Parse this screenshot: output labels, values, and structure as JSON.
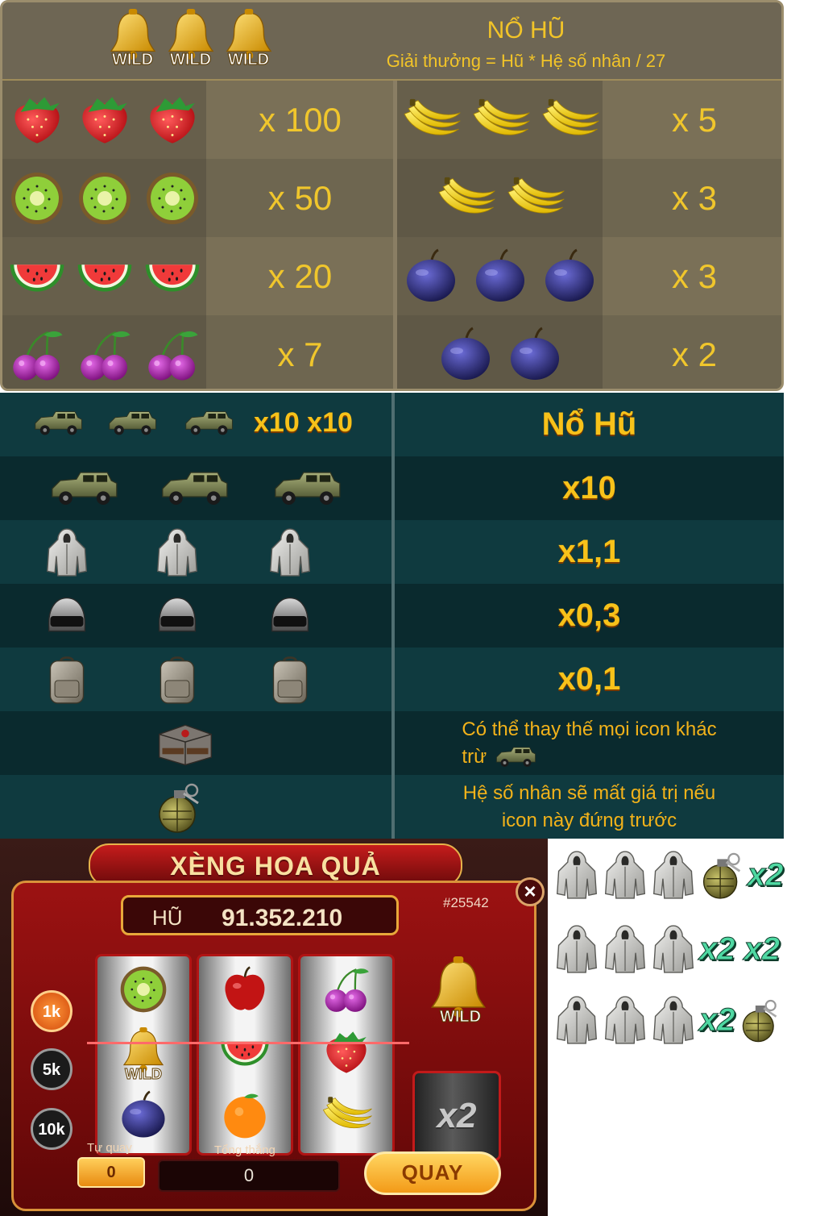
{
  "fruit_table": {
    "wild_label": "WILD",
    "title": "NỔ HŨ",
    "subtitle": "Giải thưởng = Hũ * Hệ số nhân / 27",
    "rows": [
      {
        "left_icon": "strawberry-icon",
        "left_count": 3,
        "left_mult": "x 100",
        "right_icon": "banana-icon",
        "right_count": 3,
        "right_mult": "x 5"
      },
      {
        "left_icon": "kiwi-icon",
        "left_count": 3,
        "left_mult": "x 50",
        "right_icon": "banana-icon",
        "right_count": 2,
        "right_mult": "x 3"
      },
      {
        "left_icon": "watermelon-icon",
        "left_count": 3,
        "left_mult": "x 20",
        "right_icon": "plum-icon",
        "right_count": 3,
        "right_mult": "x 3"
      },
      {
        "left_icon": "cherry-icon",
        "left_count": 3,
        "left_mult": "x 7",
        "right_icon": "plum-icon",
        "right_count": 2,
        "right_mult": "x 2"
      }
    ]
  },
  "pubg_table": {
    "rows": [
      {
        "icon": "jeep-icon",
        "count": 3,
        "left_text": "x10 x10",
        "right_text": "Nổ Hũ"
      },
      {
        "icon": "jeep-icon",
        "count": 3,
        "right_text": "x10"
      },
      {
        "icon": "jacket-icon",
        "count": 3,
        "right_text": "x1,1"
      },
      {
        "icon": "helmet-icon",
        "count": 3,
        "right_text": "x0,3"
      },
      {
        "icon": "backpack-icon",
        "count": 3,
        "right_text": "x0,1"
      },
      {
        "icon": "crate-icon",
        "count": 1,
        "right_text": "Có thể thay thế mọi icon khác",
        "right_text2": "trừ"
      },
      {
        "icon": "grenade-icon",
        "count": 1,
        "right_text": "Hệ số nhân sẽ mất giá trị nếu",
        "right_text2": "icon này đứng trước"
      }
    ]
  },
  "game": {
    "title": "XÈNG HOA QUẢ",
    "jackpot_label": "HŨ",
    "jackpot_value": "91.352.210",
    "session_id": "#25542",
    "close_icon": "close-icon",
    "bets": [
      "1k",
      "5k",
      "10k"
    ],
    "active_bet": "1k",
    "reels": [
      [
        "kiwi-icon",
        "bell-wild-icon",
        "plum-icon"
      ],
      [
        "apple-icon",
        "watermelon-icon",
        "orange-icon"
      ],
      [
        "cherry-icon",
        "strawberry-icon",
        "banana-icon"
      ]
    ],
    "wild_label": "WILD",
    "bonus_multiplier": "x2",
    "auto_spin_label": "Tự quay",
    "auto_spin_value": "0",
    "total_win_label": "Tổng thắng",
    "total_win_value": "0",
    "spin_label": "QUAY"
  },
  "combos": {
    "rows": [
      {
        "icons": [
          "jacket-icon",
          "jacket-icon",
          "jacket-icon",
          "grenade-icon"
        ],
        "mult": "x2"
      },
      {
        "icons": [
          "jacket-icon",
          "jacket-icon",
          "jacket-icon"
        ],
        "mult": "x2 x2"
      },
      {
        "icons": [
          "jacket-icon",
          "jacket-icon",
          "jacket-icon"
        ],
        "mult": "x2",
        "trail_icon": "grenade-icon"
      }
    ]
  },
  "colors": {
    "gold": "#f0c62c",
    "teal_bg": "#0c3236",
    "red_panel": "#9c1212",
    "green_mult": "#4fd8a2"
  }
}
